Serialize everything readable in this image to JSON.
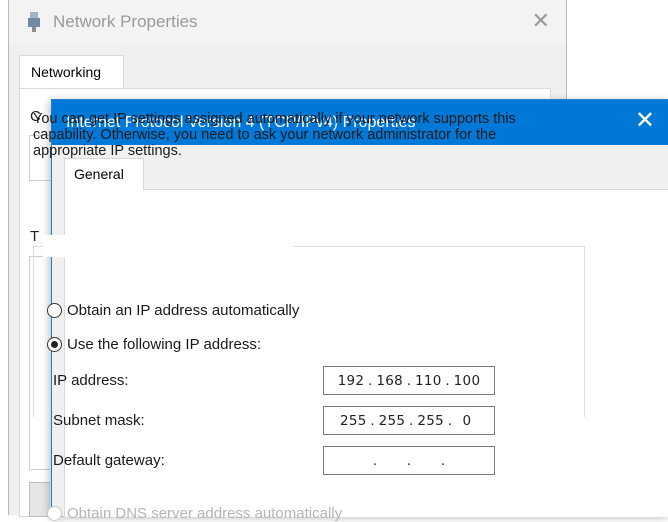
{
  "background_window": {
    "title": "Network Properties",
    "close_glyph": "✕",
    "tab": "Networking",
    "fragment_c": "C",
    "fragment_t": "T"
  },
  "dialog": {
    "title": "Internet Protocol Version 4 (TCP/IPv4) Properties",
    "close_glyph": "✕",
    "tab": "General",
    "intro_text": "You can get IP settings assigned automatically if your network supports this capability. Otherwise, you need to ask your network administrator for the appropriate IP settings.",
    "ip_options": {
      "auto_label": "Obtain an IP address automatically",
      "manual_label": "Use the following IP address:",
      "selected": "manual"
    },
    "fields": {
      "ip_address": {
        "label": "IP address:",
        "octets": [
          "192",
          "168",
          "110",
          "100"
        ]
      },
      "subnet_mask": {
        "label": "Subnet mask:",
        "octets": [
          "255",
          "255",
          "255",
          "0"
        ]
      },
      "default_gateway": {
        "label": "Default gateway:",
        "octets": [
          "",
          "",
          "",
          ""
        ]
      }
    },
    "dns_partial_label": "Obtain DNS server address automatically"
  },
  "colors": {
    "titlebar_active": "#0078d7",
    "titlebar_inactive": "#f3f3f3",
    "window_bg": "#f0f0f0"
  },
  "icons": {
    "network_adapter": "network-adapter-icon",
    "close": "close-icon"
  }
}
